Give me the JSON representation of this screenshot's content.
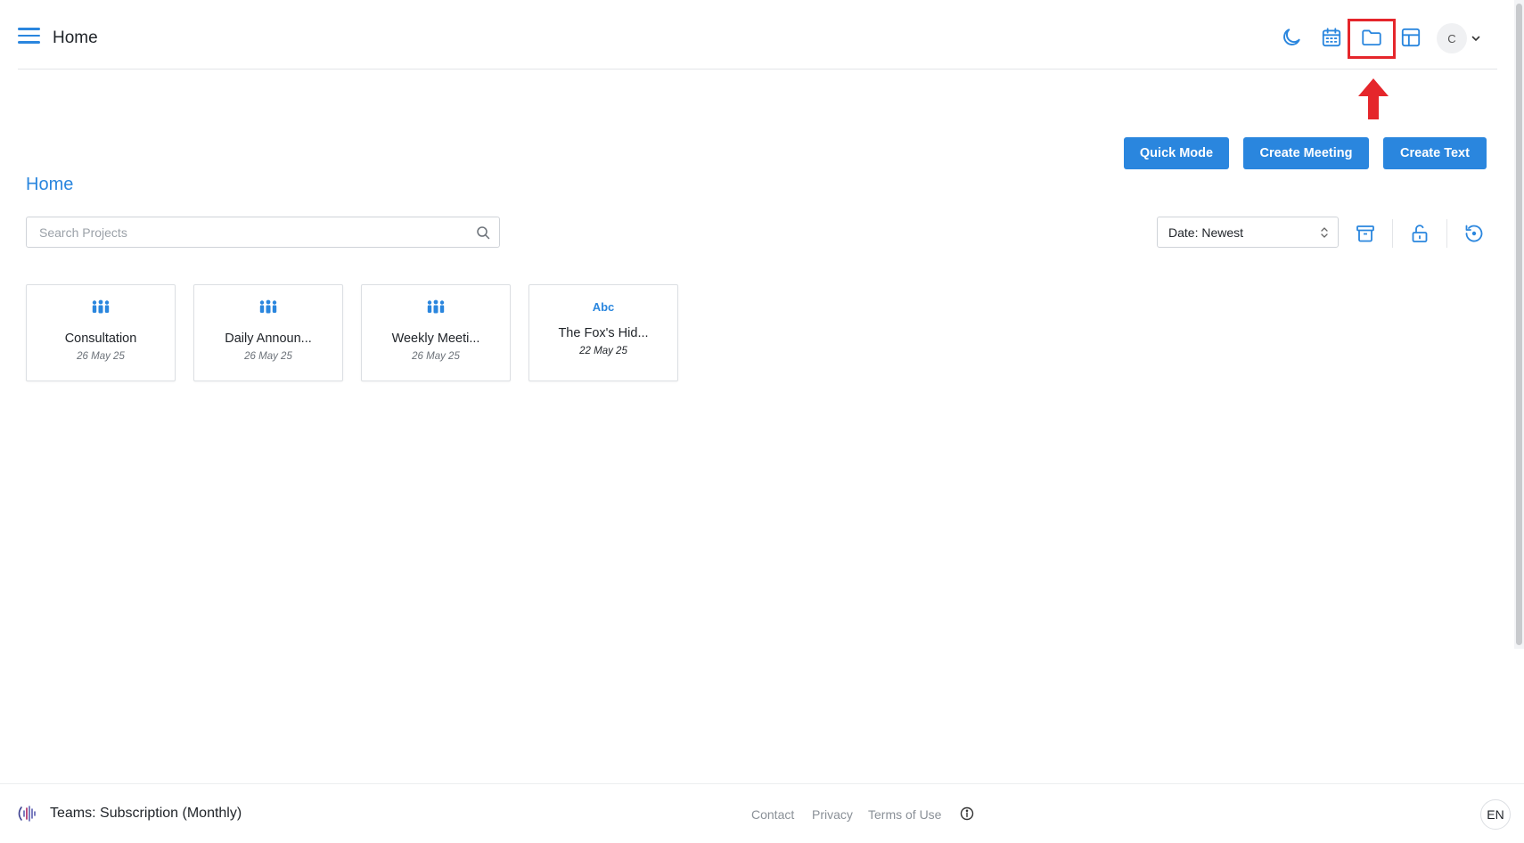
{
  "header": {
    "title": "Home",
    "icons": [
      "menu-icon",
      "moon-icon",
      "calendar-icon",
      "folder-icon",
      "layout-grid-icon"
    ],
    "avatar_initial": "C"
  },
  "actions": {
    "quick_mode": "Quick Mode",
    "create_meeting": "Create Meeting",
    "create_text": "Create Text"
  },
  "page": {
    "title": "Home"
  },
  "search": {
    "placeholder": "Search Projects",
    "value": ""
  },
  "sort": {
    "selected": "Date: Newest"
  },
  "projects": [
    {
      "name": "Consultation",
      "date": "26 May 25",
      "type": "meeting"
    },
    {
      "name": "Daily Announ...",
      "date": "26 May 25",
      "type": "meeting"
    },
    {
      "name": "Weekly Meeti...",
      "date": "26 May 25",
      "type": "meeting"
    },
    {
      "name": "The Fox's Hid...",
      "date": "22 May 25",
      "type": "text",
      "type_label": "Abc"
    }
  ],
  "footer": {
    "subscription": "Teams: Subscription (Monthly)",
    "links": [
      "Contact",
      "Privacy",
      "Terms of Use"
    ],
    "language": "EN"
  },
  "colors": {
    "accent": "#2a86de",
    "highlight": "#e5262b"
  }
}
